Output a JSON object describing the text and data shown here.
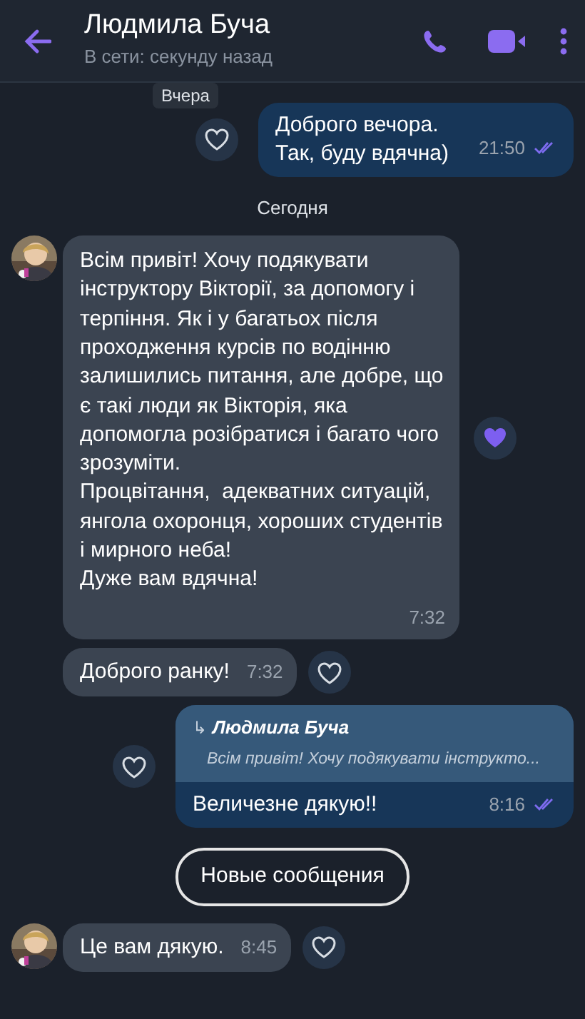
{
  "header": {
    "title": "Людмила Буча",
    "subtitle": "В сети: секунду назад"
  },
  "messages": [
    {
      "kind": "date",
      "text": "Вчера"
    },
    {
      "kind": "outgoing",
      "text": "Доброго вечора.\nТак, буду вдячна)",
      "time": "21:50",
      "read": true,
      "liked": false
    },
    {
      "kind": "date",
      "text": "Сегодня"
    },
    {
      "kind": "incoming",
      "avatar": true,
      "text": "Всім привіт! Хочу подякувати інструктору Вікторії, за допомогу і терпіння. Як і у багатьох після проходження курсів по водінню залишились питання, але добре, що є такі люди як Вікторія, яка допомогла розібратися і багато чого зрозуміти.\nПроцвітання,  адекватних ситуацій, янгола охоронця, хороших студентів і мирного неба!\nДуже вам вдячна!",
      "time": "7:32",
      "liked": true
    },
    {
      "kind": "incoming",
      "avatar": false,
      "text": "Доброго ранку!",
      "time": "7:32",
      "liked": false
    },
    {
      "kind": "outgoing",
      "reply": {
        "arrow": "↳",
        "author": "Людмила Буча",
        "text": "Всім привіт! Хочу подякувати інструкто..."
      },
      "text": "Величезне дякую!!",
      "time": "8:16",
      "read": true,
      "liked": false
    },
    {
      "kind": "divider",
      "text": "Новые сообщения"
    },
    {
      "kind": "incoming",
      "avatar": true,
      "text": "Це вам дякую.",
      "time": "8:45",
      "liked": false
    }
  ]
}
